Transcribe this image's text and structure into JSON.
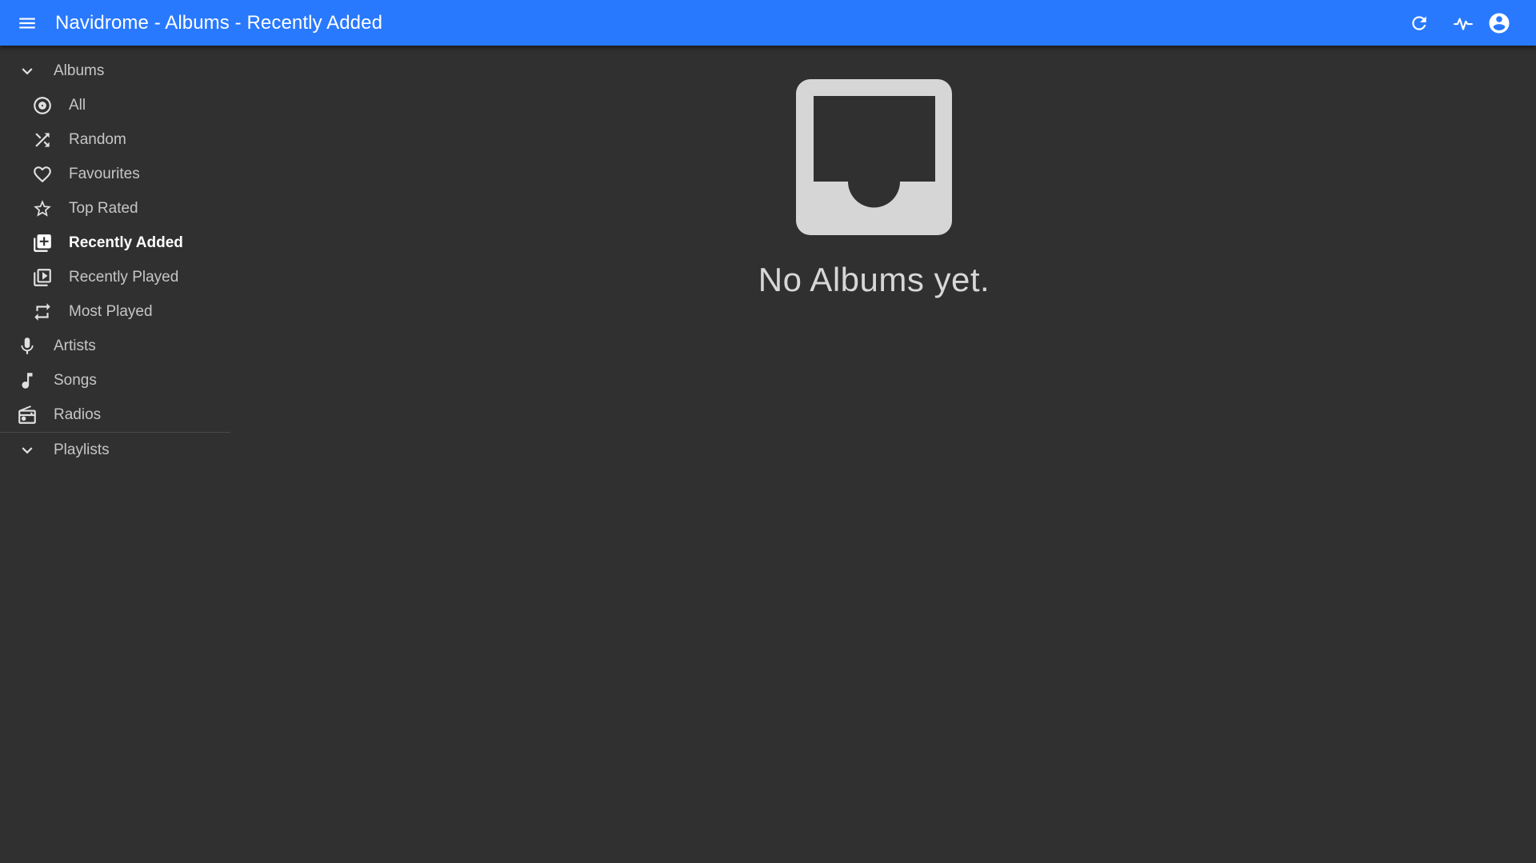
{
  "appbar": {
    "title": "Navidrome - Albums - Recently Added",
    "menu_icon": "menu-icon",
    "actions": [
      {
        "icon": "refresh-icon"
      },
      {
        "icon": "activity-icon"
      },
      {
        "icon": "account-circle-icon"
      }
    ]
  },
  "sidebar": {
    "albums_group": {
      "label": "Albums",
      "icon": "chevron-down-icon",
      "expanded": true
    },
    "album_items": [
      {
        "label": "All",
        "icon": "album-disc-icon"
      },
      {
        "label": "Random",
        "icon": "shuffle-icon"
      },
      {
        "label": "Favourites",
        "icon": "heart-outline-icon"
      },
      {
        "label": "Top Rated",
        "icon": "star-outline-icon"
      },
      {
        "label": "Recently Added",
        "icon": "library-add-icon",
        "active": true
      },
      {
        "label": "Recently Played",
        "icon": "video-library-icon"
      },
      {
        "label": "Most Played",
        "icon": "repeat-icon"
      }
    ],
    "top_items": [
      {
        "label": "Artists",
        "icon": "microphone-icon"
      },
      {
        "label": "Songs",
        "icon": "music-note-icon"
      },
      {
        "label": "Radios",
        "icon": "radio-icon"
      }
    ],
    "playlists_group": {
      "label": "Playlists",
      "icon": "chevron-down-icon",
      "expanded": true
    }
  },
  "main": {
    "empty_icon": "inbox-icon",
    "empty_message": "No Albums yet."
  },
  "colors": {
    "appbar": "#2979ff",
    "background": "#303030",
    "icon": "#e0e0e0",
    "empty_icon": "#d6d6d6"
  }
}
